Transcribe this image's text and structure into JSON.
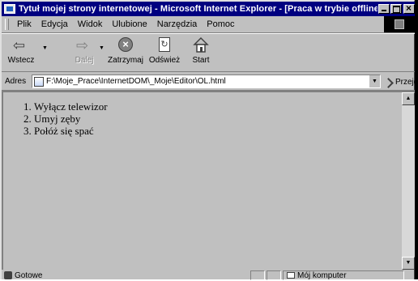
{
  "window": {
    "title": "Tytuł mojej strony internetowej - Microsoft Internet Explorer  - [Praca w trybie offline]"
  },
  "menubar": {
    "items": [
      "Plik",
      "Edycja",
      "Widok",
      "Ulubione",
      "Narzędzia",
      "Pomoc"
    ]
  },
  "toolbar": {
    "buttons": [
      {
        "label": "Wstecz",
        "icon": "back-arrow-icon",
        "enabled": true
      },
      {
        "label": "Dalej",
        "icon": "forward-arrow-icon",
        "enabled": false
      },
      {
        "label": "Zatrzymaj",
        "icon": "stop-icon",
        "enabled": true
      },
      {
        "label": "Odśwież",
        "icon": "refresh-icon",
        "enabled": true
      },
      {
        "label": "Start",
        "icon": "home-icon",
        "enabled": true
      }
    ]
  },
  "addressbar": {
    "label": "Adres",
    "url": "F:\\Moje_Prace\\InternetDOM\\_Moje\\Editor\\OL.html",
    "go_label": "Przejdź"
  },
  "content": {
    "list": [
      "Wyłącz telewizor",
      "Umyj zęby",
      "Połóż się spać"
    ]
  },
  "statusbar": {
    "status": "Gotowe",
    "zone": "Mój komputer"
  }
}
